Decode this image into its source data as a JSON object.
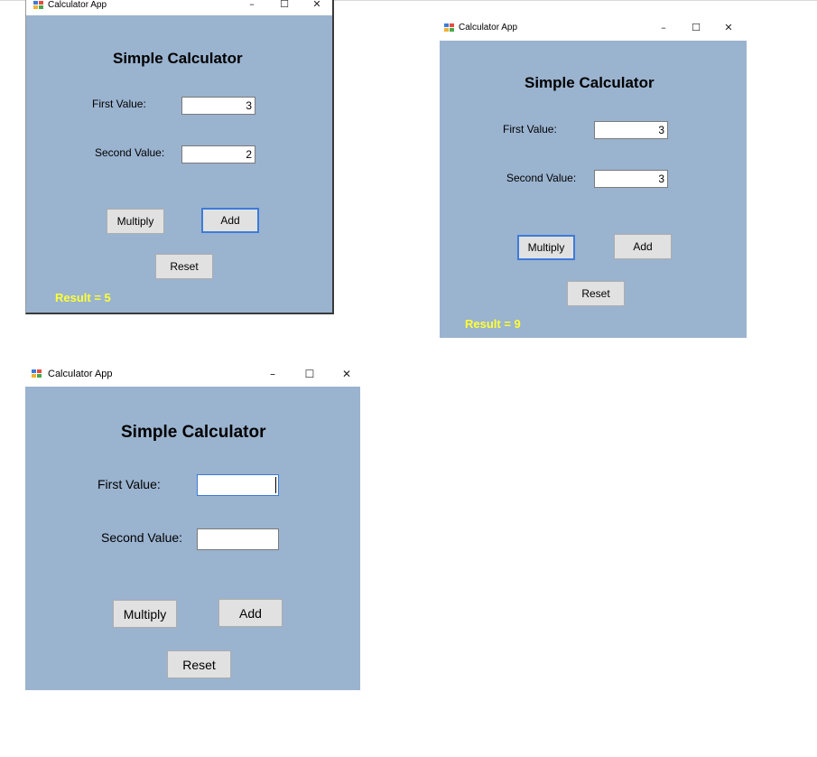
{
  "windows": [
    {
      "title": "Calculator App",
      "heading": "Simple Calculator",
      "first_label": "First Value:",
      "first_value": "3",
      "second_label": "Second Value:",
      "second_value": "2",
      "multiply_label": "Multiply",
      "add_label": "Add",
      "reset_label": "Reset",
      "result": "Result = 5"
    },
    {
      "title": "Calculator App",
      "heading": "Simple Calculator",
      "first_label": "First Value:",
      "first_value": "3",
      "second_label": "Second Value:",
      "second_value": "3",
      "multiply_label": "Multiply",
      "add_label": "Add",
      "reset_label": "Reset",
      "result": "Result = 9"
    },
    {
      "title": "Calculator App",
      "heading": "Simple Calculator",
      "first_label": "First Value:",
      "first_value": "",
      "second_label": "Second Value:",
      "second_value": "",
      "multiply_label": "Multiply",
      "add_label": "Add",
      "reset_label": "Reset",
      "result": ""
    }
  ],
  "window_controls": {
    "minimize": "–",
    "maximize": "☐",
    "close": "✕"
  },
  "colors": {
    "client_bg": "#9ab3cf",
    "result_text": "#ffff33",
    "focus_border": "#3d7bd9"
  }
}
